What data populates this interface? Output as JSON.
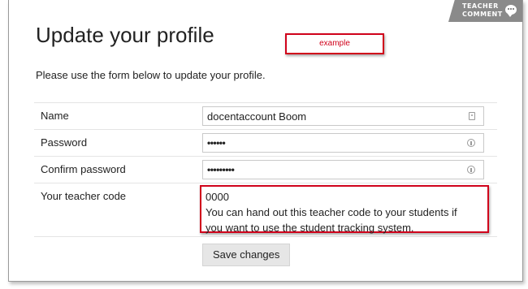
{
  "page": {
    "title": "Update your profile",
    "intro": "Please use the form below to update your profile.",
    "annotation_example": "example"
  },
  "tab": {
    "line1": "TEACHER",
    "line2": "COMMENT",
    "icon": "speech-bubble-icon"
  },
  "form": {
    "name": {
      "label": "Name",
      "value": "docentaccount Boom",
      "icon": "contact-card-icon"
    },
    "password": {
      "label": "Password",
      "value": "••••••",
      "icon": "key-icon"
    },
    "confirm": {
      "label": "Confirm password",
      "value": "•••••••••",
      "icon": "key-icon"
    },
    "code": {
      "label": "Your teacher code",
      "value": "0000",
      "hint_line1": "You can hand out this teacher code to your students if",
      "hint_line2": "you want to use the student tracking system."
    },
    "save_label": "Save changes"
  },
  "colors": {
    "annotation": "#d0021b",
    "tab_bg": "#8a8a8a",
    "button_bg": "#e6e6e6"
  }
}
